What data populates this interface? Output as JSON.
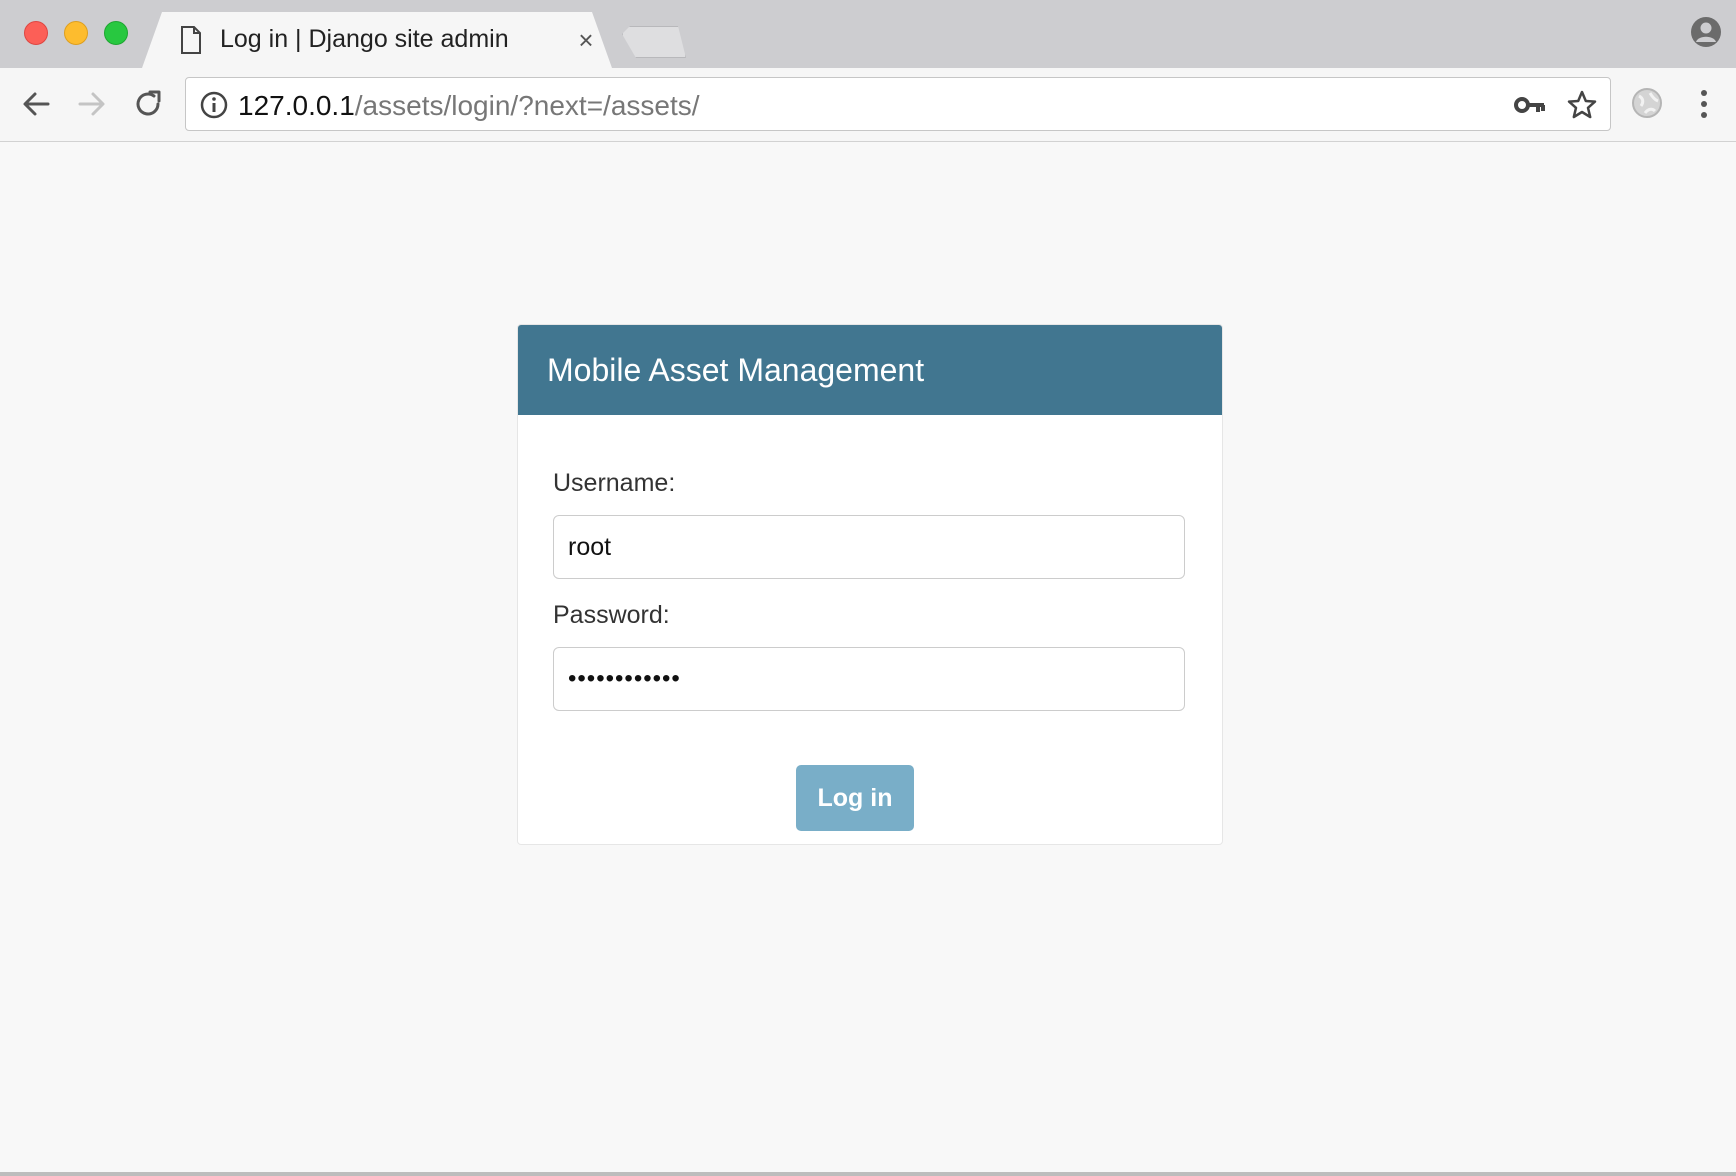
{
  "browser": {
    "tab_title": "Log in | Django site admin",
    "tab_close": "×",
    "url_host": "127.0.0.1",
    "url_path": "/assets/login/?next=/assets/",
    "icons": {
      "tab": "document-icon",
      "back": "back-arrow-icon",
      "forward": "forward-arrow-icon",
      "reload": "reload-icon",
      "info": "info-icon",
      "key": "key-icon",
      "star": "star-icon",
      "extension": "globe-extension-icon",
      "menu": "kebab-menu-icon",
      "profile": "profile-icon"
    }
  },
  "login": {
    "site_name": "Mobile Asset Management",
    "username_label": "Username:",
    "username_value": "root",
    "password_label": "Password:",
    "password_value": "••••••••••••",
    "submit_label": "Log in"
  },
  "colors": {
    "header_bg": "#417690",
    "button_bg": "#79aec8",
    "page_bg": "#f8f8f8"
  }
}
